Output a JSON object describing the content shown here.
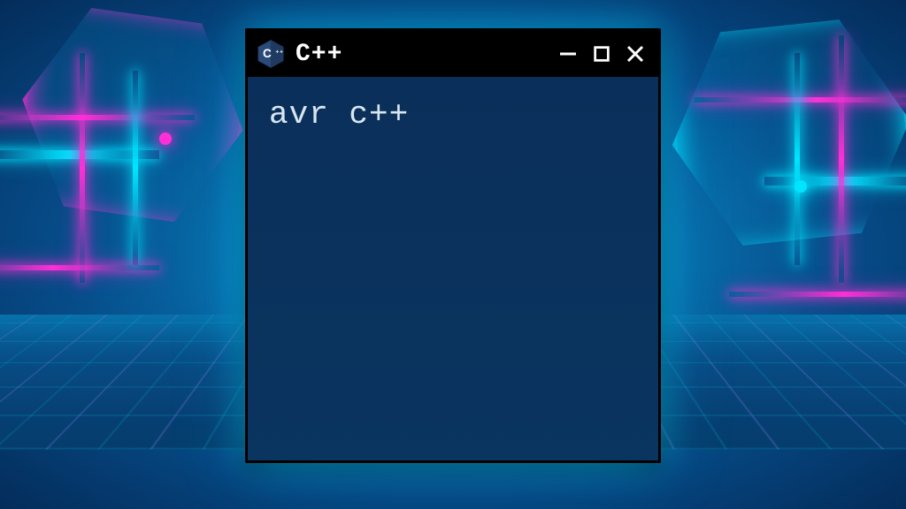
{
  "window": {
    "title": "C++",
    "icon_name": "cpp-hex-icon",
    "controls": {
      "minimize": "minimize",
      "maximize": "maximize",
      "close": "close"
    }
  },
  "content": {
    "line1": "avr c++"
  },
  "colors": {
    "window_bg": "#0a2f5a",
    "titlebar_bg": "#000000",
    "neon_cyan": "#00e5ff",
    "neon_magenta": "#ff2fd8"
  }
}
